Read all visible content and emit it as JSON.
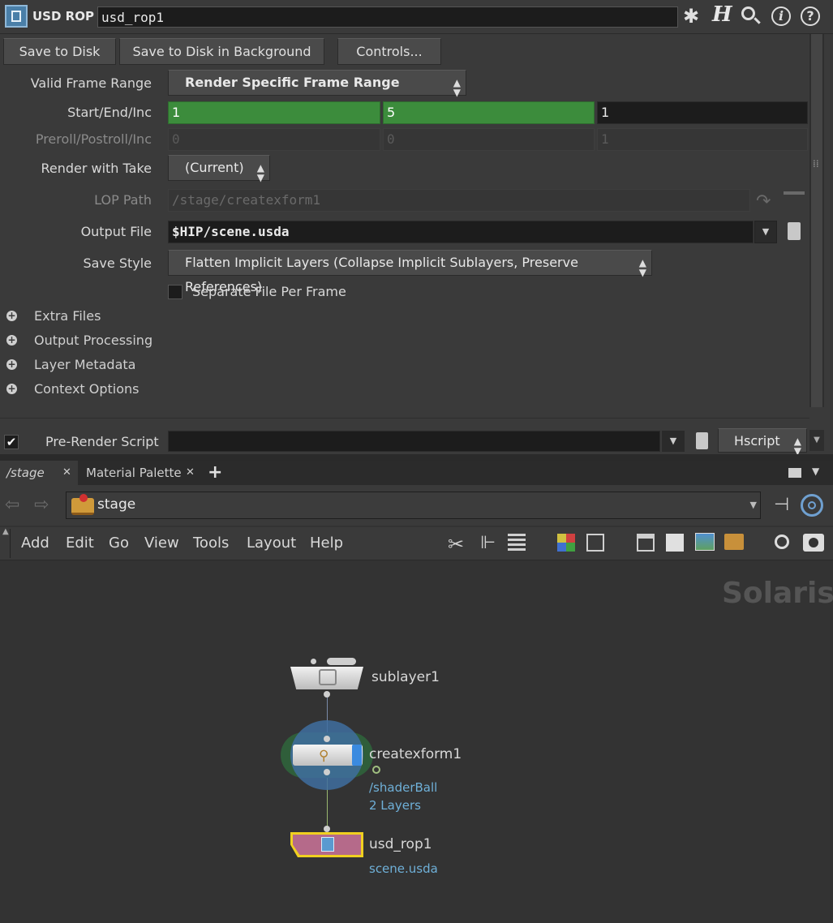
{
  "header": {
    "node_type": "USD ROP",
    "node_name": "usd_rop1",
    "icons": [
      "gear-icon",
      "houdini-help-icon",
      "search-icon",
      "info-icon",
      "help-icon"
    ]
  },
  "buttons": {
    "save_to_disk": "Save to Disk",
    "save_bg": "Save to Disk in Background",
    "controls": "Controls..."
  },
  "params": {
    "valid_frame_range": {
      "label": "Valid Frame Range",
      "value": "Render Specific Frame Range"
    },
    "start_end_inc": {
      "label": "Start/End/Inc",
      "values": [
        "1",
        "5",
        "1"
      ]
    },
    "preroll": {
      "label": "Preroll/Postroll/Inc",
      "values": [
        "0",
        "0",
        "1"
      ]
    },
    "render_take": {
      "label": "Render with Take",
      "value": "(Current)"
    },
    "lop_path": {
      "label": "LOP Path",
      "value": "/stage/createxform1"
    },
    "output_file": {
      "label": "Output File",
      "value": "$HIP/scene.usda"
    },
    "save_style": {
      "label": "Save Style",
      "value": "Flatten Implicit Layers (Collapse Implicit Sublayers, Preserve References)"
    },
    "separate_file": {
      "label": "Separate File Per Frame",
      "checked": false
    },
    "folders": [
      "Extra Files",
      "Output Processing",
      "Layer Metadata",
      "Context Options"
    ],
    "pre_render": {
      "label": "Pre-Render Script",
      "checked": true,
      "value": "",
      "language": "Hscript"
    }
  },
  "network": {
    "tabs": [
      {
        "label": "/stage",
        "active": true
      },
      {
        "label": "Material Palette",
        "active": false
      }
    ],
    "add_tab": "+",
    "path": "stage",
    "menu": [
      "Add",
      "Edit",
      "Go",
      "View",
      "Tools",
      "Layout",
      "Help"
    ],
    "context_label": "Solaris",
    "nodes": [
      {
        "name": "sublayer1"
      },
      {
        "name": "createxform1",
        "info": [
          "/shaderBall",
          "2 Layers"
        ]
      },
      {
        "name": "usd_rop1",
        "info": [
          "scene.usda"
        ]
      }
    ]
  },
  "colors": {
    "green_field": "#3c8c3c",
    "rop_node": "#b56a8a",
    "rop_outline": "#f0d020",
    "info_text": "#6fb0d8"
  }
}
